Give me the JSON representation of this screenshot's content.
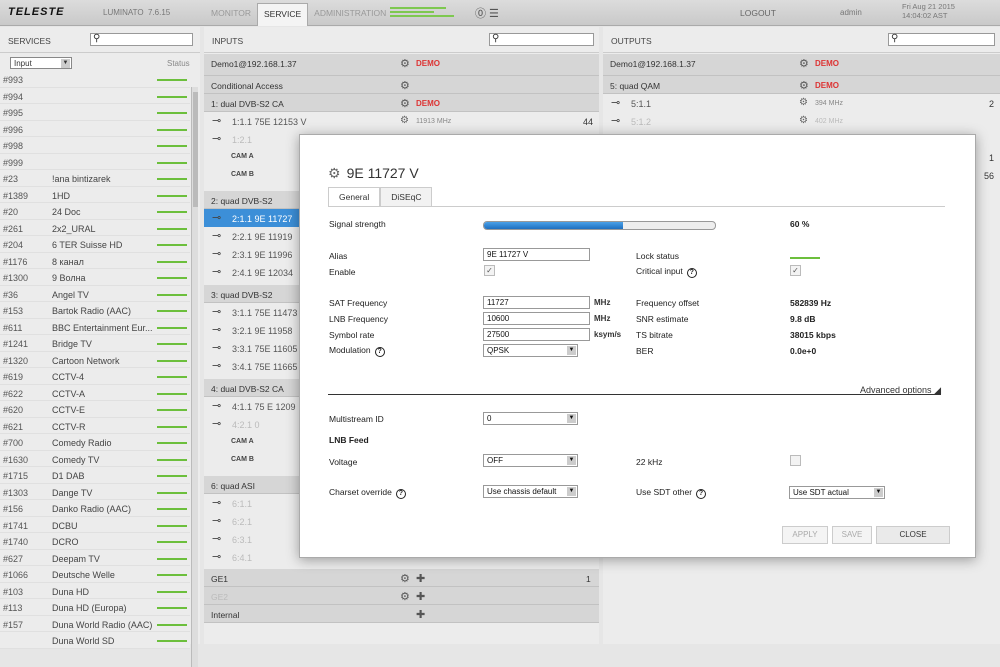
{
  "app": {
    "logo": "TELESTE",
    "product": "LUMINATO",
    "version": "7.6.15",
    "nav": [
      "MONITOR",
      "SERVICE",
      "ADMINISTRATION"
    ],
    "active_nav": "SERVICE",
    "logout": "LOGOUT",
    "user": "admin",
    "date": "Fri Aug 21 2015",
    "time": "14:04:02 AST"
  },
  "services": {
    "title": "SERVICES",
    "filter": "Input",
    "status_header": "Status",
    "items": [
      {
        "id": "#993",
        "name": ""
      },
      {
        "id": "#994",
        "name": ""
      },
      {
        "id": "#995",
        "name": ""
      },
      {
        "id": "#996",
        "name": ""
      },
      {
        "id": "#998",
        "name": ""
      },
      {
        "id": "#999",
        "name": ""
      },
      {
        "id": "#23",
        "name": "!ana bintizarek"
      },
      {
        "id": "#1389",
        "name": "1HD"
      },
      {
        "id": "#20",
        "name": "24 Doc"
      },
      {
        "id": "#261",
        "name": "2x2_URAL"
      },
      {
        "id": "#204",
        "name": "6 TER Suisse HD"
      },
      {
        "id": "#1176",
        "name": "8 канал"
      },
      {
        "id": "#1300",
        "name": "9 Волна"
      },
      {
        "id": "#36",
        "name": "Angel TV"
      },
      {
        "id": "#153",
        "name": "Bartok Radio (AAC)"
      },
      {
        "id": "#611",
        "name": "BBC Entertainment Eur..."
      },
      {
        "id": "#1241",
        "name": "Bridge TV"
      },
      {
        "id": "#1320",
        "name": "Cartoon Network"
      },
      {
        "id": "#619",
        "name": "CCTV-4"
      },
      {
        "id": "#622",
        "name": "CCTV-A"
      },
      {
        "id": "#620",
        "name": "CCTV-E"
      },
      {
        "id": "#621",
        "name": "CCTV-R"
      },
      {
        "id": "#700",
        "name": "Comedy Radio"
      },
      {
        "id": "#1630",
        "name": "Comedy TV"
      },
      {
        "id": "#1715",
        "name": "D1 DAB"
      },
      {
        "id": "#1303",
        "name": "Dange TV"
      },
      {
        "id": "#156",
        "name": "Danko Radio (AAC)"
      },
      {
        "id": "#1741",
        "name": "DCBU"
      },
      {
        "id": "#1740",
        "name": "DCRO"
      },
      {
        "id": "#627",
        "name": "Deepam TV"
      },
      {
        "id": "#1066",
        "name": "Deutsche Welle"
      },
      {
        "id": "#103",
        "name": "Duna HD"
      },
      {
        "id": "#113",
        "name": "Duna HD (Europa)"
      },
      {
        "id": "#157",
        "name": "Duna World Radio (AAC)"
      },
      {
        "id": "",
        "name": "Duna World SD"
      }
    ]
  },
  "inputs": {
    "title": "INPUTS",
    "device": "Demo1@192.168.1.37",
    "demo": "DEMO",
    "ca": "Conditional Access",
    "g1": "1: dual DVB-S2 CA",
    "r111": "1:1.1  75E 12153 V",
    "r111f": "11913 MHz",
    "r111n": "44",
    "r121": "1:2.1",
    "cama": "CAM A",
    "camb": "CAM B",
    "g2": "2: quad DVB-S2",
    "r211": "2:1.1  9E 11727",
    "r221": "2:2.1  9E 11919",
    "r231": "2:3.1  9E 11996",
    "r241": "2:4.1  9E 12034",
    "g3": "3: quad DVB-S2",
    "r311": "3:1.1  75E 11473",
    "r321": "3:2.1  9E 11958",
    "r331": "3:3.1  75E 11605",
    "r341": "3:4.1  75E 11665",
    "g4": "4: dual DVB-S2 CA",
    "r411": "4:1.1  75 E 1209",
    "r421": "4:2.1  0",
    "cama2": "CAM A",
    "camb2": "CAM B",
    "g6": "6: quad ASI",
    "r611": "6:1.1",
    "r621": "6:2.1",
    "r631": "6:3.1",
    "r641": "6:4.1",
    "ge1": "GE1",
    "ge1n": "1",
    "ge2": "GE2",
    "internal": "Internal"
  },
  "outputs": {
    "title": "OUTPUTS",
    "device": "Demo1@192.168.1.37",
    "demo": "DEMO",
    "g5": "5: quad QAM",
    "r511": "5:1.1",
    "r511f": "394 MHz",
    "r511n": "2",
    "r512": "5:1.2",
    "r512f": "402 MHz",
    "n1": "1",
    "n56": "56"
  },
  "dialog": {
    "title": "9E 11727 V",
    "tabs": [
      "General",
      "DiSEqC"
    ],
    "signal_label": "Signal strength",
    "signal_value": "60 %",
    "signal_level": 0.6,
    "alias_label": "Alias",
    "alias": "9E 11727 V",
    "enable_label": "Enable",
    "lock_label": "Lock status",
    "critical_label": "Critical input",
    "sat_label": "SAT Frequency",
    "sat": "11727",
    "lnb_label": "LNB Frequency",
    "lnb": "10600",
    "sym_label": "Symbol rate",
    "sym": "27500",
    "mod_label": "Modulation",
    "mod": "QPSK",
    "mhz": "MHz",
    "ksyms": "ksym/s",
    "foff_label": "Frequency offset",
    "foff": "582839 Hz",
    "snr_label": "SNR estimate",
    "snr": "9.8 dB",
    "ts_label": "TS bitrate",
    "ts": "38015 kbps",
    "ber_label": "BER",
    "ber": "0.0e+0",
    "advanced": "Advanced options",
    "mis_label": "Multistream ID",
    "mis": "0",
    "lnbfeed": "LNB Feed",
    "volt_label": "Voltage",
    "volt": "OFF",
    "khz_label": "22 kHz",
    "charset_label": "Charset override",
    "charset": "Use chassis default",
    "sdt_label": "Use SDT other",
    "sdt": "Use SDT actual",
    "apply": "APPLY",
    "save": "SAVE",
    "close": "CLOSE"
  }
}
